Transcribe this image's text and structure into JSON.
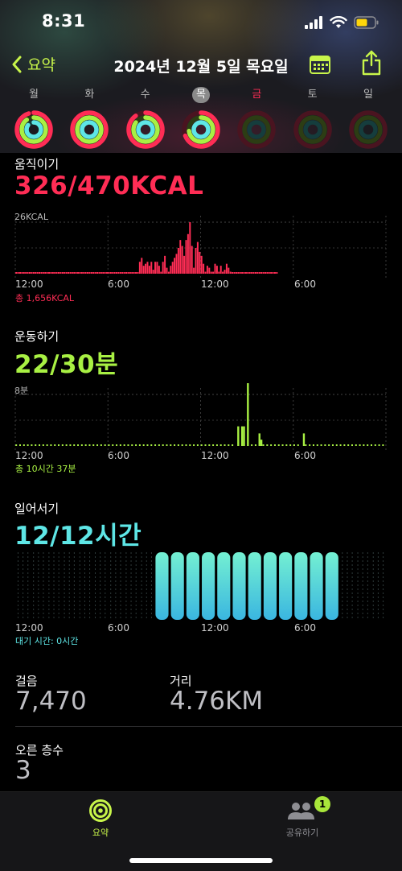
{
  "status_bar": {
    "time": "8:31"
  },
  "nav": {
    "back_label": "요약",
    "title": "2024년 12월 5일 목요일"
  },
  "colors": {
    "move": "#ff2d55",
    "exercise": "#a8f043",
    "stand": "#5ee6e6",
    "accent": "#c8f54a"
  },
  "week": [
    {
      "label": "월",
      "move": 0.95,
      "exercise": 0.9,
      "stand": 0.85,
      "selected": false,
      "red": false,
      "dim": false
    },
    {
      "label": "화",
      "move": 1.0,
      "exercise": 1.0,
      "stand": 0.95,
      "selected": false,
      "red": false,
      "dim": false
    },
    {
      "label": "수",
      "move": 0.9,
      "exercise": 0.85,
      "stand": 1.0,
      "selected": false,
      "red": false,
      "dim": false
    },
    {
      "label": "목",
      "move": 0.69,
      "exercise": 0.73,
      "stand": 1.0,
      "selected": true,
      "red": false,
      "dim": false
    },
    {
      "label": "금",
      "move": 0,
      "exercise": 0,
      "stand": 0,
      "selected": false,
      "red": true,
      "dim": true
    },
    {
      "label": "토",
      "move": 0,
      "exercise": 0,
      "stand": 0,
      "selected": false,
      "red": false,
      "dim": true
    },
    {
      "label": "일",
      "move": 0,
      "exercise": 0,
      "stand": 0,
      "selected": false,
      "red": false,
      "dim": true
    }
  ],
  "move": {
    "title": "움직이기",
    "value": "326/470KCAL",
    "scale_label": "26KCAL",
    "x_labels": [
      "12:00",
      "6:00",
      "12:00",
      "6:00"
    ],
    "total": "총 1,656KCAL"
  },
  "exercise": {
    "title": "운동하기",
    "value": "22/30분",
    "scale_label": "8분",
    "x_labels": [
      "12:00",
      "6:00",
      "12:00",
      "6:00"
    ],
    "total": "총 10시간 37분"
  },
  "stand": {
    "title": "일어서기",
    "value": "12/12시간",
    "x_labels": [
      "12:00",
      "6:00",
      "12:00",
      "6:00"
    ],
    "total": "대기 시간: 0시간"
  },
  "stats": {
    "steps_label": "걸음",
    "steps_value": "7,470",
    "distance_label": "거리",
    "distance_value": "4.76KM",
    "floors_label": "오른 층수",
    "floors_value": "3"
  },
  "tabbar": {
    "summary_label": "요약",
    "sharing_label": "공유하기",
    "sharing_badge": "1"
  },
  "chart_data": [
    {
      "type": "bar",
      "title": "움직이기",
      "unit": "KCAL",
      "x_labels": [
        "12:00",
        "6:00",
        "12:00",
        "6:00"
      ],
      "ymax": 26,
      "values": [
        0,
        0,
        0,
        0,
        0,
        0,
        0,
        0,
        0,
        0,
        0,
        0,
        0,
        0,
        0,
        0,
        0,
        0,
        0,
        0,
        0,
        0,
        0,
        0,
        0,
        0,
        0,
        0,
        0,
        0,
        0,
        0,
        0,
        0,
        0,
        0,
        0,
        0,
        0,
        0,
        0,
        0,
        0,
        0,
        0,
        0,
        0,
        0,
        0,
        0,
        0,
        0,
        0,
        0,
        0,
        0,
        0,
        0,
        0,
        0,
        0,
        0,
        0,
        0,
        6,
        8,
        4,
        5,
        6,
        4,
        6,
        2,
        6,
        6,
        4,
        1,
        6,
        9,
        3,
        1,
        4,
        6,
        8,
        10,
        13,
        17,
        14,
        9,
        17,
        20,
        26,
        14,
        3,
        13,
        16,
        11,
        9,
        5,
        1,
        4,
        3,
        1,
        1,
        5,
        4,
        1,
        4,
        1,
        2,
        5,
        3,
        1,
        0,
        0,
        0,
        0,
        0,
        0,
        0,
        0,
        0,
        0,
        0,
        0,
        0,
        0,
        0,
        0,
        0,
        0,
        0,
        0,
        0,
        0,
        0,
        0
      ]
    },
    {
      "type": "bar",
      "title": "운동하기",
      "unit": "분",
      "x_labels": [
        "12:00",
        "6:00",
        "12:00",
        "6:00"
      ],
      "ymax": 8,
      "bars": [
        {
          "slot": 115,
          "value": 2.5
        },
        {
          "slot": 117,
          "value": 2.5
        },
        {
          "slot": 118,
          "value": 2.5
        },
        {
          "slot": 120,
          "value": 8
        },
        {
          "slot": 126,
          "value": 1.6
        },
        {
          "slot": 127,
          "value": 0.8
        },
        {
          "slot": 149,
          "value": 1.6
        }
      ]
    },
    {
      "type": "bar",
      "title": "일어서기",
      "x_labels": [
        "12:00",
        "6:00",
        "12:00",
        "6:00"
      ],
      "hours_stood": [
        0,
        0,
        0,
        0,
        0,
        0,
        0,
        0,
        0,
        1,
        1,
        1,
        1,
        1,
        1,
        1,
        1,
        1,
        1,
        1,
        1,
        0,
        0,
        0
      ]
    }
  ]
}
